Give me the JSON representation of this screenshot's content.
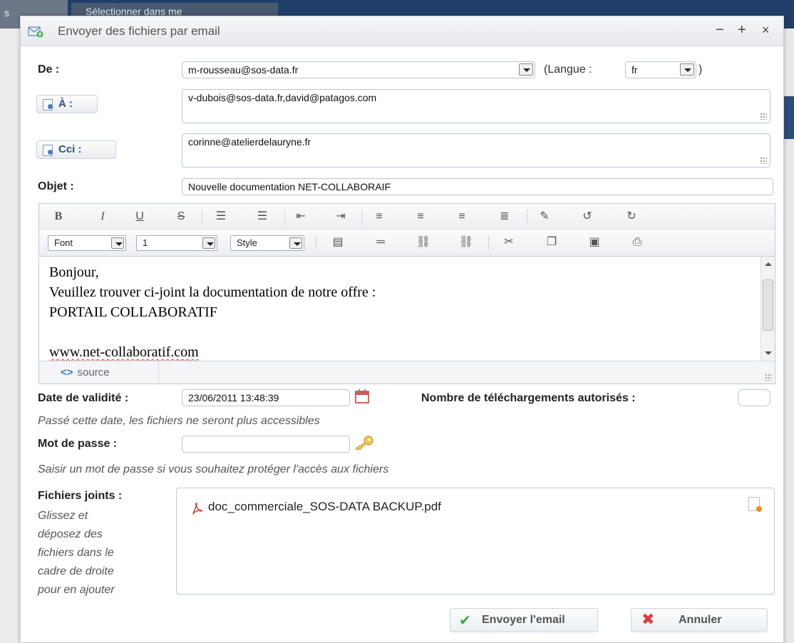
{
  "background": {
    "left_tab_text": "s",
    "top_button_text": "Sélectionner dans me"
  },
  "dialog": {
    "title": "Envoyer des fichiers par email",
    "controls": {
      "minimize": "−",
      "maximize": "+",
      "close": "×"
    }
  },
  "form": {
    "from_label": "De :",
    "from_value": "m-rousseau@sos-data.fr",
    "language_label": "(Langue :",
    "language_value": "fr",
    "language_close": ")",
    "to_label": "À :",
    "to_value": "v-dubois@sos-data.fr,david@patagos.com",
    "bcc_label": "Cci :",
    "bcc_value": "corinne@atelierdelauryne.fr",
    "subject_label": "Objet :",
    "subject_value": "Nouvelle documentation NET-COLLABORAIF"
  },
  "editor": {
    "toolbar": {
      "bold": "B",
      "italic": "I",
      "underline": "U",
      "strike": "S",
      "font_select": "Font",
      "size_select": "1",
      "style_select": "Style"
    },
    "body_lines": [
      "Bonjour,",
      "Veuillez trouver ci-joint la documentation de notre offre :",
      "PORTAIL COLLABORATIF",
      "",
      "www.net-collaboratif.com"
    ],
    "source_label": "source"
  },
  "validity": {
    "label": "Date de validité :",
    "value": "23/06/2011 13:48:39",
    "hint": "Passé cette date, les fichiers ne seront plus accessibles",
    "downloads_label": "Nombre de téléchargements autorisés :",
    "downloads_value": ""
  },
  "password": {
    "label": "Mot de passe :",
    "value": "",
    "hint": "Saisir un mot de passe si vous souhaitez protéger l'accès aux fichiers"
  },
  "attachments": {
    "label": "Fichiers joints :",
    "help_lines": [
      "Glissez et",
      "déposez des",
      "fichiers dans le",
      "cadre de droite",
      "pour en ajouter"
    ],
    "files": [
      "doc_commerciale_SOS-DATA BACKUP.pdf"
    ]
  },
  "actions": {
    "send_label": "Envoyer l'email",
    "cancel_label": "Annuler"
  },
  "colors": {
    "title_bar": "#e6e9ed",
    "link_blue": "#2a4f80",
    "send_green": "#3aa64a",
    "cancel_red": "#e0393c"
  }
}
